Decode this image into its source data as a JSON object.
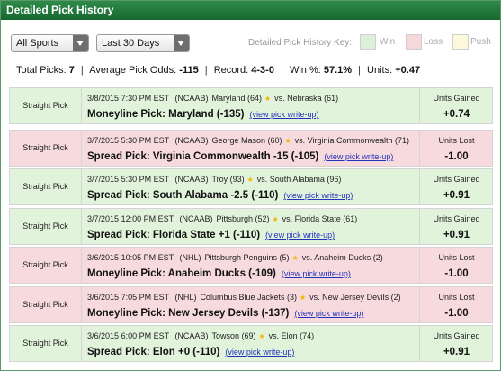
{
  "header": {
    "title": "Detailed Pick History"
  },
  "filters": {
    "sport": "All Sports",
    "period": "Last 30 Days",
    "key_label": "Detailed Pick History Key:",
    "key": {
      "win": "Win",
      "loss": "Loss",
      "push": "Push"
    },
    "colors": {
      "win": "#dff0d8",
      "loss": "#f6d8da",
      "push": "#fcf8dc",
      "header": "#1f7a3a"
    }
  },
  "summary": {
    "total_label": "Total Picks:",
    "total": "7",
    "odds_label": "Average Pick Odds:",
    "odds": "-115",
    "record_label": "Record:",
    "record": "4-3-0",
    "win_label": "Win %:",
    "win": "57.1%",
    "units_label": "Units:",
    "units": "+0.47",
    "sep": "|"
  },
  "picks": [
    {
      "type": "Straight Pick",
      "result": "win",
      "date": "3/8/2015",
      "time": "7:30 PM EST",
      "league": "(NCAAB)",
      "team1": "Maryland (64)",
      "vs": "vs. Nebraska (61)",
      "pick": "Moneyline Pick: Maryland (-135)",
      "writeup": "(view pick write-up)",
      "units_label": "Units Gained",
      "units": "+0.74"
    },
    {
      "type": "Straight Pick",
      "result": "loss",
      "date": "3/7/2015",
      "time": "5:30 PM EST",
      "league": "(NCAAB)",
      "team1": "George Mason (60)",
      "vs": "vs. Virginia Commonwealth (71)",
      "pick": "Spread Pick: Virginia Commonwealth -15 (-105)",
      "writeup": "(view pick write-up)",
      "units_label": "Units Lost",
      "units": "-1.00"
    },
    {
      "type": "Straight Pick",
      "result": "win",
      "date": "3/7/2015",
      "time": "5:30 PM EST",
      "league": "(NCAAB)",
      "team1": "Troy (93)",
      "vs": "vs. South Alabama (96)",
      "pick": "Spread Pick: South Alabama -2.5 (-110)",
      "writeup": "(view pick write-up)",
      "units_label": "Units Gained",
      "units": "+0.91"
    },
    {
      "type": "Straight Pick",
      "result": "win",
      "date": "3/7/2015",
      "time": "12:00 PM EST",
      "league": "(NCAAB)",
      "team1": "Pittsburgh (52)",
      "vs": "vs. Florida State (61)",
      "pick": "Spread Pick: Florida State +1 (-110)",
      "writeup": "(view pick write-up)",
      "units_label": "Units Gained",
      "units": "+0.91"
    },
    {
      "type": "Straight Pick",
      "result": "loss",
      "date": "3/6/2015",
      "time": "10:05 PM EST",
      "league": "(NHL)",
      "team1": "Pittsburgh Penguins (5)",
      "vs": "vs. Anaheim Ducks (2)",
      "pick": "Moneyline Pick: Anaheim Ducks (-109)",
      "writeup": "(view pick write-up)",
      "units_label": "Units Lost",
      "units": "-1.00"
    },
    {
      "type": "Straight Pick",
      "result": "loss",
      "date": "3/6/2015",
      "time": "7:05 PM EST",
      "league": "(NHL)",
      "team1": "Columbus Blue Jackets (3)",
      "vs": "vs. New Jersey Devils (2)",
      "pick": "Moneyline Pick: New Jersey Devils (-137)",
      "writeup": "(view pick write-up)",
      "units_label": "Units Lost",
      "units": "-1.00"
    },
    {
      "type": "Straight Pick",
      "result": "win",
      "date": "3/6/2015",
      "time": "6:00 PM EST",
      "league": "(NCAAB)",
      "team1": "Towson (69)",
      "vs": "vs. Elon (74)",
      "pick": "Spread Pick: Elon +0 (-110)",
      "writeup": "(view pick write-up)",
      "units_label": "Units Gained",
      "units": "+0.91"
    }
  ]
}
